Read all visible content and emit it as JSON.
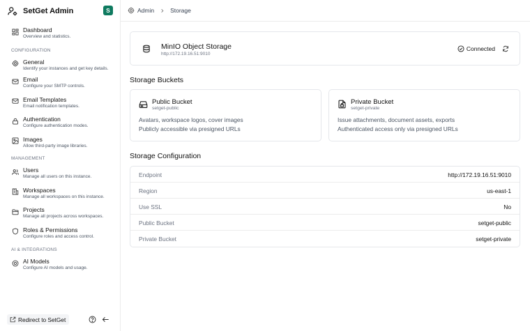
{
  "brand": {
    "title": "SetGet Admin",
    "avatar_letter": "S",
    "avatar_color": "#0e7a5f"
  },
  "sidebar": {
    "top": [
      {
        "title": "Dashboard",
        "sub": "Overview and statistics.",
        "icon": "dashboard-icon"
      }
    ],
    "sections": [
      {
        "label": "CONFIGURATION",
        "items": [
          {
            "title": "General",
            "sub": "Identify your instances and get key details.",
            "icon": "gear-icon"
          },
          {
            "title": "Email",
            "sub": "Configure your SMTP controls.",
            "icon": "mail-icon"
          },
          {
            "title": "Email Templates",
            "sub": "Email notification templates.",
            "icon": "mail-template-icon"
          },
          {
            "title": "Authentication",
            "sub": "Configure authentication modes.",
            "icon": "lock-icon"
          },
          {
            "title": "Images",
            "sub": "Allow third-party image libraries.",
            "icon": "image-icon"
          }
        ]
      },
      {
        "label": "MANAGEMENT",
        "items": [
          {
            "title": "Users",
            "sub": "Manage all users on this instance.",
            "icon": "users-icon"
          },
          {
            "title": "Workspaces",
            "sub": "Manage all workspaces on this instance.",
            "icon": "building-icon"
          },
          {
            "title": "Projects",
            "sub": "Manage all projects across workspaces.",
            "icon": "folder-icon"
          },
          {
            "title": "Roles & Permissions",
            "sub": "Configure roles and access control.",
            "icon": "shield-icon"
          }
        ]
      },
      {
        "label": "AI & INTEGRATIONS",
        "items": [
          {
            "title": "AI Models",
            "sub": "Configure AI models and usage.",
            "icon": "ai-icon"
          }
        ]
      }
    ],
    "footer": {
      "redirect_label": "Redirect to SetGet"
    }
  },
  "breadcrumb": {
    "root": "Admin",
    "current": "Storage"
  },
  "connection": {
    "title": "MinIO Object Storage",
    "url": "http://172.19.16.51:9010",
    "status": "Connected"
  },
  "buckets_title": "Storage Buckets",
  "buckets": [
    {
      "title": "Public Bucket",
      "name": "setget-public",
      "line1": "Avatars, workspace logos, cover images",
      "line2": "Publicly accessible via presigned URLs",
      "icon": "hard-drive-icon"
    },
    {
      "title": "Private Bucket",
      "name": "setget-private",
      "line1": "Issue attachments, document assets, exports",
      "line2": "Authenticated access only via presigned URLs",
      "icon": "file-lock-icon"
    }
  ],
  "config_title": "Storage Configuration",
  "config": [
    {
      "label": "Endpoint",
      "value": "http://172.19.16.51:9010"
    },
    {
      "label": "Region",
      "value": "us-east-1"
    },
    {
      "label": "Use SSL",
      "value": "No"
    },
    {
      "label": "Public Bucket",
      "value": "setget-public"
    },
    {
      "label": "Private Bucket",
      "value": "setget-private"
    }
  ]
}
